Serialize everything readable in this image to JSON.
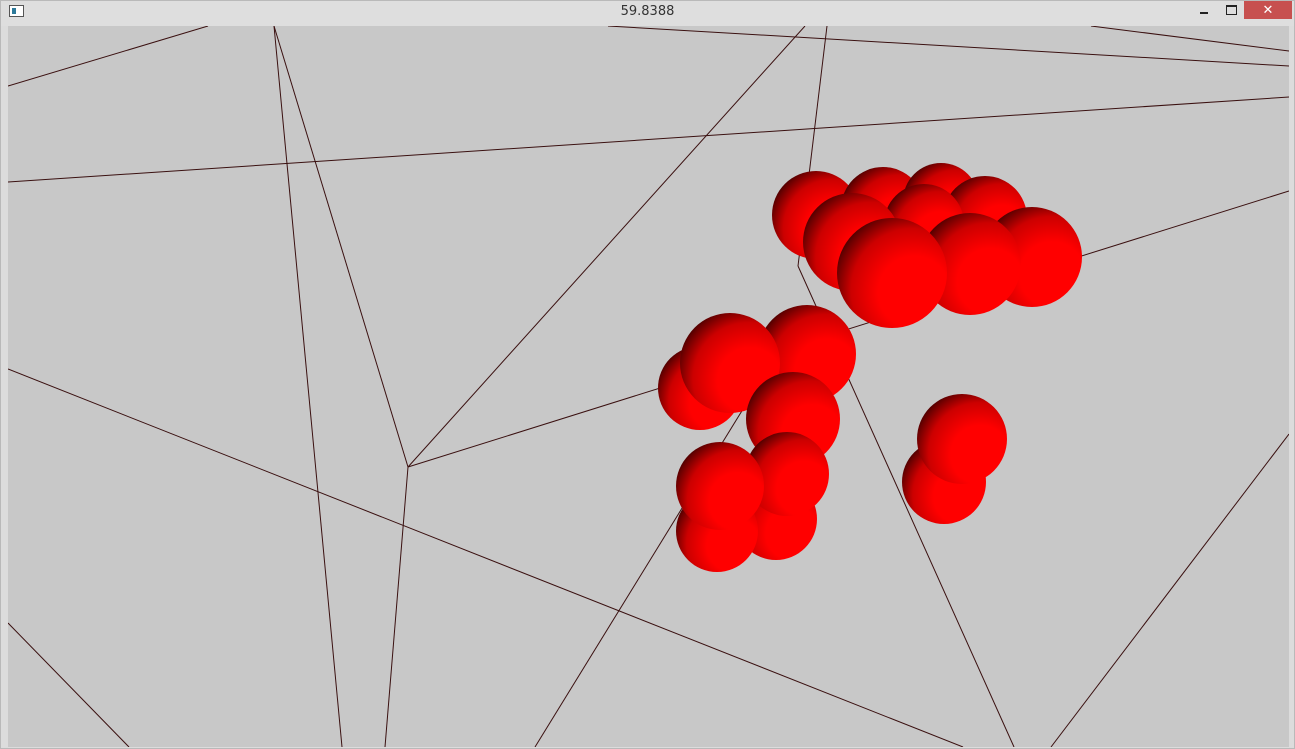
{
  "window": {
    "title": "59.8388",
    "app_icon": "window-app-icon",
    "controls": {
      "minimize_icon": "minimize-icon",
      "maximize_icon": "maximize-icon",
      "close_icon": "close-icon",
      "close_glyph": "✕"
    }
  },
  "scene": {
    "background_color": "#c8c8c8",
    "wire_color": "#3a1010",
    "sphere_color": "#ff0000",
    "sphere_shadow_color": "#2a0000"
  }
}
